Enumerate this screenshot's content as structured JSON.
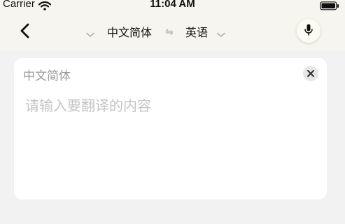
{
  "status_bar": {
    "carrier": "Carrier",
    "time": "11:04 AM",
    "wifi_icon": "wifi-icon",
    "battery_icon": "battery-icon"
  },
  "nav": {
    "back_icon": "chevron-left-icon",
    "source_language": "中文简体",
    "target_language": "英语",
    "swap_icon": "⇋",
    "mic_icon": "microphone-icon"
  },
  "input_card": {
    "language_label": "中文简体",
    "placeholder": "请输入要翻译的内容",
    "value": "",
    "clear_icon": "close-icon"
  },
  "colors": {
    "header_bg": "#f6f5ef",
    "page_bg": "#f2f2f2",
    "card_bg": "#ffffff",
    "placeholder": "#c4c4c4",
    "faint_footer": "#d9c8ef"
  }
}
